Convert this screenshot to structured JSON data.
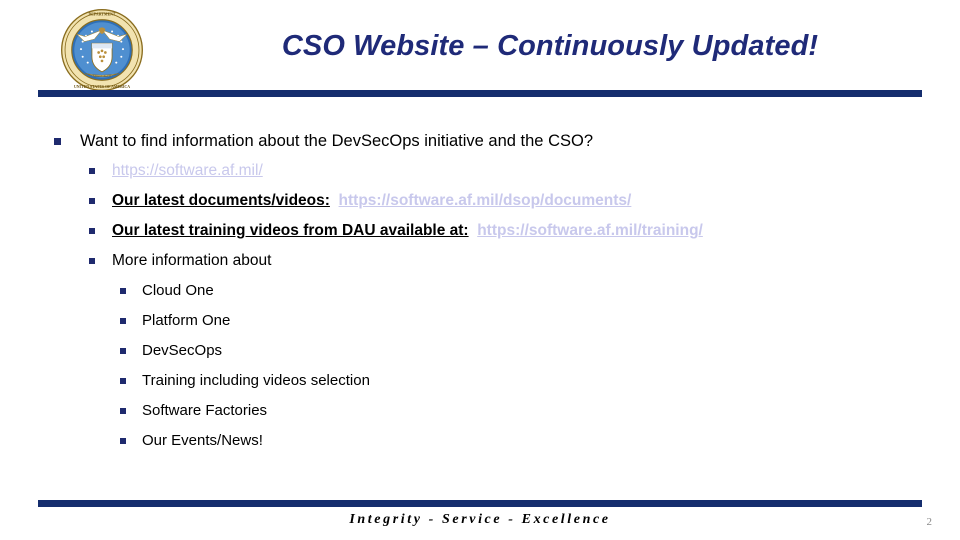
{
  "slide": {
    "title": "CSO Website – Continuously Updated!",
    "page_number": "2",
    "footer_motto": "Integrity - Service - Excellence",
    "colors": {
      "title": "#1f2a78",
      "rule": "#152d6e",
      "bullet": "#1f2a6e",
      "hyperlink": "#c8c8ec",
      "body_text": "#000000",
      "page_number": "#8a8a8a"
    },
    "seal": {
      "name": "department-of-the-air-force-seal",
      "ring_text_top": "DEPARTMENT OF THE AIR FORCE",
      "ring_text_bottom": "UNITED STATES OF AMERICA",
      "scroll_text": "MDCCCXLVII"
    }
  },
  "content": {
    "bullets": [
      {
        "level": 1,
        "text": "Want to find information about the DevSecOps initiative and the CSO?"
      },
      {
        "level": 2,
        "link_only": true,
        "link": "https://software.af.mil/"
      },
      {
        "level": 2,
        "label": "Our latest documents/videos:",
        "link": "https://software.af.mil/dsop/documents/"
      },
      {
        "level": 2,
        "label": "Our latest training videos from DAU available at:",
        "link": "https://software.af.mil/training/"
      },
      {
        "level": 2,
        "text": "More information about",
        "children": [
          {
            "level": 3,
            "text": "Cloud One"
          },
          {
            "level": 3,
            "text": "Platform One"
          },
          {
            "level": 3,
            "text": "DevSecOps"
          },
          {
            "level": 3,
            "text": "Training including videos selection"
          },
          {
            "level": 3,
            "text": "Software Factories"
          },
          {
            "level": 3,
            "text": "Our Events/News!"
          }
        ]
      }
    ]
  }
}
